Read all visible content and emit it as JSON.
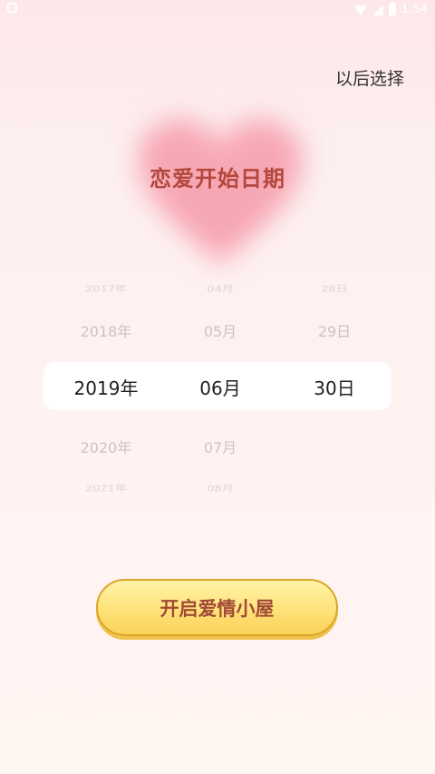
{
  "status_bar": {
    "time": "1:54",
    "icons": [
      "app-notification-icon",
      "wifi-icon",
      "signal-icon",
      "battery-icon"
    ]
  },
  "header": {
    "skip_label": "以后选择"
  },
  "title": "恋爱开始日期",
  "date_picker": {
    "years": [
      "2017年",
      "2018年",
      "2019年",
      "2020年",
      "2021年"
    ],
    "months": [
      "04月",
      "05月",
      "06月",
      "07月",
      "08月"
    ],
    "days": [
      "28日",
      "29日",
      "30日"
    ],
    "selected": {
      "year": "2019年",
      "month": "06月",
      "day": "30日"
    }
  },
  "start_button": {
    "label": "开启爱情小屋"
  },
  "colors": {
    "title": "#b3473c",
    "button_fill": "#ffe27a",
    "button_border": "#d9a52a",
    "heart_glow": "#f7a7b4"
  }
}
